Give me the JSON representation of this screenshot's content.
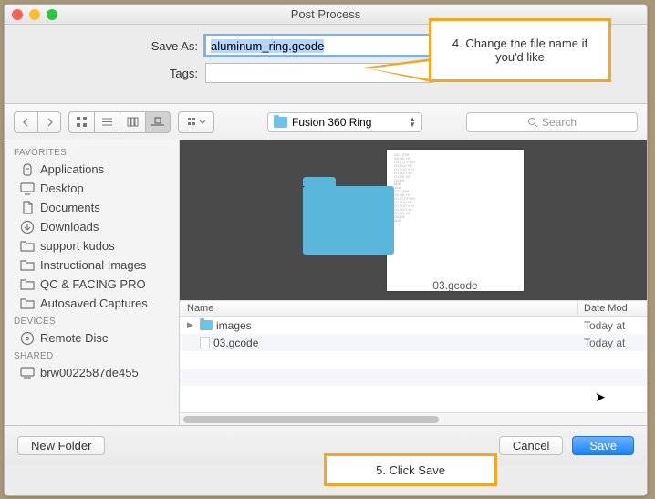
{
  "window": {
    "title": "Post Process"
  },
  "form": {
    "save_as_label": "Save As:",
    "save_as_value": "aluminum_ring.gcode",
    "tags_label": "Tags:",
    "tags_value": ""
  },
  "toolbar": {
    "folder_name": "Fusion 360 Ring",
    "search_placeholder": "Search"
  },
  "sidebar": {
    "sections": [
      {
        "header": "Favorites",
        "items": [
          "Applications",
          "Desktop",
          "Documents",
          "Downloads",
          "support kudos",
          "Instructional Images",
          "QC & FACING PRO",
          "Autosaved Captures"
        ]
      },
      {
        "header": "Devices",
        "items": [
          "Remote Disc"
        ]
      },
      {
        "header": "Shared",
        "items": [
          "brw0022587de455"
        ]
      }
    ]
  },
  "preview": {
    "file_label": "03.gcode"
  },
  "list": {
    "col_name": "Name",
    "col_date": "Date Mod",
    "rows": [
      {
        "name": "images",
        "type": "folder",
        "date": "Today at"
      },
      {
        "name": "03.gcode",
        "type": "file",
        "date": "Today at"
      }
    ]
  },
  "footer": {
    "new_folder": "New Folder",
    "cancel": "Cancel",
    "save": "Save"
  },
  "callouts": {
    "c1": "4. Change the file name if you'd like",
    "c2": "5. Click Save"
  }
}
